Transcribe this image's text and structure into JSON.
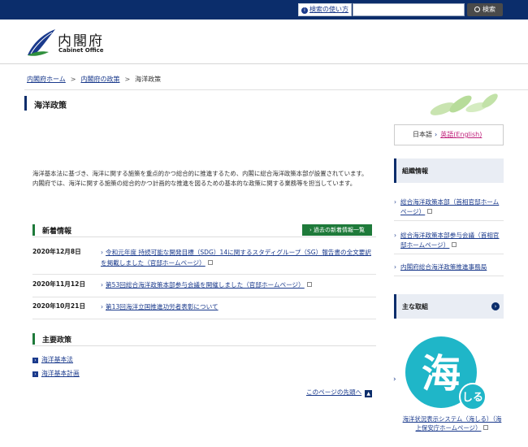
{
  "header": {
    "howto_label": "検索の使い方",
    "search_placeholder": "",
    "search_button": "検索",
    "logo_jp": "内閣府",
    "logo_en": "Cabinet Office"
  },
  "breadcrumb": {
    "items": [
      "内閣府ホーム",
      "内閣府の政策"
    ],
    "current": "海洋政策",
    "separator": ">"
  },
  "page_title": "海洋政策",
  "language": {
    "ja": "日本語",
    "en": "英語(English)"
  },
  "intro": [
    "海洋基本法に基づき、海洋に関する施策を重点的かつ総合的に推進するため、内閣に総合海洋政策本部が設置されています。",
    "内閣府では、海洋に関する施策の総合的かつ計画的な推進を図るための基本的な政策に関する業務等を担当しています。"
  ],
  "news": {
    "title": "新着情報",
    "past_button": "過去の新着情報一覧",
    "items": [
      {
        "date": "2020年12月8日",
        "text": "令和元年度 持続可能な開発目標（SDG）14に関するスタディグループ（SG）報告書の全文要訳を掲載しました（官邸ホームページ）",
        "external": true
      },
      {
        "date": "2020年11月12日",
        "text": "第53回総合海洋政策本部参与会議を開催しました（官邸ホームページ）",
        "external": true
      },
      {
        "date": "2020年10月21日",
        "text": "第13回海洋立国推進功労者表彰について",
        "external": false
      }
    ]
  },
  "policies": {
    "title": "主要政策",
    "items": [
      "海洋基本法",
      "海洋基本計画"
    ]
  },
  "page_top": "このページの先頭へ",
  "sidebar": {
    "org_title": "組織情報",
    "org_links": [
      {
        "text": "総合海洋政策本部（首相官邸ホームページ）",
        "external": true
      },
      {
        "text": "総合海洋政策本部参与会議（首相官邸ホームページ）",
        "external": true
      },
      {
        "text": "内閣府総合海洋政策推進事務局",
        "external": false
      }
    ],
    "main_title": "主な取組",
    "banner_glyph": "海",
    "banner_sub": "しる",
    "banner_caption": "海洋状況表示システム（海しる）（海上保安庁ホームページ）"
  },
  "colors": {
    "header_navy": "#0b2d6b",
    "section_green": "#1e7a3a",
    "link_blue": "#1a3a8c",
    "english_pink": "#c0217b",
    "banner_teal": "#1fb6c8"
  }
}
